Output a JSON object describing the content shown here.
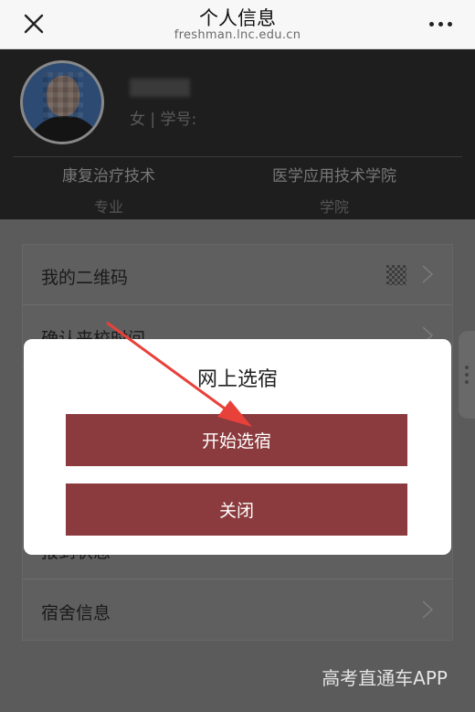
{
  "nav": {
    "title": "个人信息",
    "url": "freshman.lnc.edu.cn"
  },
  "profile": {
    "gender_row": "女 | 学号:",
    "major_value": "康复治疗技术",
    "major_label": "专业",
    "college_value": "医学应用技术学院",
    "college_label": "学院"
  },
  "menu": {
    "items": [
      {
        "label": "我的二维码"
      },
      {
        "label": "确认来校时间"
      },
      {
        "label": "报到状态"
      },
      {
        "label": "宿舍信息"
      }
    ]
  },
  "modal": {
    "title": "网上选宿",
    "start_button": "开始选宿",
    "close_button": "关闭"
  },
  "colors": {
    "button": "#8b3a3d",
    "arrow": "#e8413a"
  },
  "icons": [
    "close-icon",
    "more-icon",
    "qr-code-icon",
    "chevron-right-icon"
  ],
  "watermark": "高考直通车APP"
}
